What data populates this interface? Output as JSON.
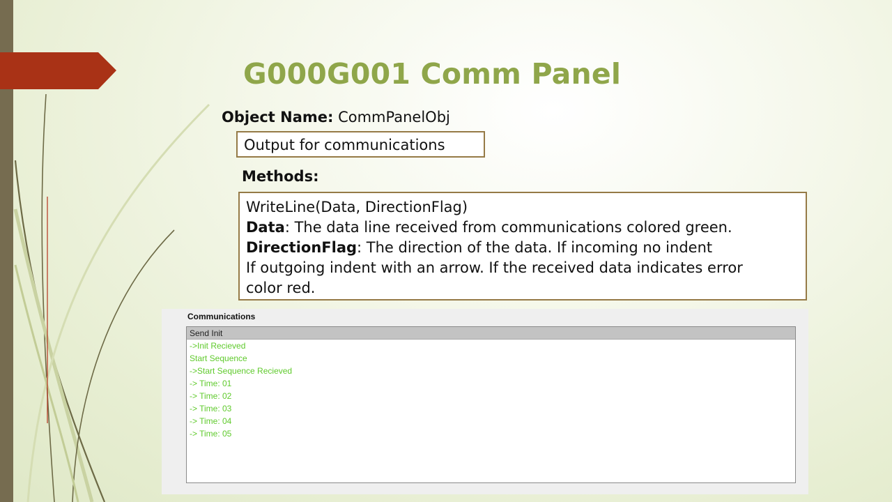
{
  "slide": {
    "title": "G000G001 Comm Panel",
    "object_name_label": "Object Name:",
    "object_name_value": " CommPanelObj",
    "description": "Output for communications",
    "methods_label": "Methods:",
    "method_signature": "WriteLine(Data, DirectionFlag)",
    "param_data_name": "Data",
    "param_data_desc": ": The data line received from communications colored green.",
    "param_flag_name": "DirectionFlag",
    "param_flag_desc": ": The direction of the data. If incoming no indent",
    "flag_line2": "If outgoing indent with an arrow. If the received data indicates error",
    "flag_line3": "color red."
  },
  "comm_panel": {
    "title": "Communications",
    "lines": [
      "Send Init",
      "->Init Recieved",
      "Start Sequence",
      "->Start Sequence Recieved",
      "-> Time: 01",
      "-> Time: 02",
      "-> Time: 03",
      "-> Time: 04",
      "-> Time: 05"
    ],
    "selected_index": 0
  },
  "colors": {
    "title_green": "#8fa64a",
    "box_border": "#957a46",
    "arrow_red": "#a93216",
    "comm_green": "#5fca2c",
    "left_bar": "#766c50"
  }
}
